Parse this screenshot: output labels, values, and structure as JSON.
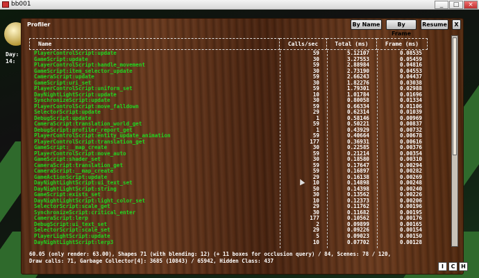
{
  "window": {
    "title": "bb001",
    "minimize": "_",
    "maximize": "□",
    "close": "×"
  },
  "hud": {
    "line1": "Day:",
    "line2": "14:"
  },
  "profiler": {
    "title": "Profiler",
    "buttons": {
      "by_name": "By Name",
      "by_frame": "By Frame",
      "resume": "Resume",
      "close": "X"
    },
    "columns": {
      "name": "Name",
      "calls": "Calls/sec",
      "total": "Total (ms)",
      "frame": "Frame (ms)"
    },
    "rows": [
      {
        "name": "PlayerControlScript:update",
        "calls": "59",
        "total": "5.12107",
        "frame": "0.08535"
      },
      {
        "name": "GameScript:update",
        "calls": "30",
        "total": "3.27553",
        "frame": "0.05459"
      },
      {
        "name": "PlayerControlScript:handle_movement",
        "calls": "59",
        "total": "2.88984",
        "frame": "0.04816"
      },
      {
        "name": "GameScript:item_selector_update",
        "calls": "30",
        "total": "2.73190",
        "frame": "0.04553"
      },
      {
        "name": "CameraScript:update",
        "calls": "59",
        "total": "2.66243",
        "frame": "0.04437"
      },
      {
        "name": "GameScript:uri_set",
        "calls": "30",
        "total": "1.82276",
        "frame": "0.03038"
      },
      {
        "name": "PlayerControlScript:uniform_set",
        "calls": "59",
        "total": "1.79301",
        "frame": "0.02988"
      },
      {
        "name": "DayNightLightScript:update",
        "calls": "10",
        "total": "1.01784",
        "frame": "0.01696"
      },
      {
        "name": "SynchronizeScript:update",
        "calls": "30",
        "total": "0.80058",
        "frame": "0.01334"
      },
      {
        "name": "PlayerControlScript:move_falldown",
        "calls": "59",
        "total": "0.66334",
        "frame": "0.01106"
      },
      {
        "name": "SelectorScript:update",
        "calls": "29",
        "total": "0.62314",
        "frame": "0.01039"
      },
      {
        "name": "DebugScript:update",
        "calls": "1",
        "total": "0.58146",
        "frame": "0.00969"
      },
      {
        "name": "CameraScript:translation_world_get",
        "calls": "59",
        "total": "0.50221",
        "frame": "0.00837"
      },
      {
        "name": "DebugScript:profiler_report_get",
        "calls": "1",
        "total": "0.43929",
        "frame": "0.00732"
      },
      {
        "name": "PlayerControlScript:entity_update_animation",
        "calls": "59",
        "total": "0.40664",
        "frame": "0.00678"
      },
      {
        "name": "PlayerControlScript:translation_get",
        "calls": "177",
        "total": "0.36931",
        "frame": "0.00616"
      },
      {
        "name": "GameScript:__map_create",
        "calls": "30",
        "total": "0.22585",
        "frame": "0.00376"
      },
      {
        "name": "PlayerControlScript:move_auto",
        "calls": "59",
        "total": "0.21214",
        "frame": "0.00354"
      },
      {
        "name": "GameScript:shader_set",
        "calls": "30",
        "total": "0.18580",
        "frame": "0.00310"
      },
      {
        "name": "CameraScript:translation_get",
        "calls": "59",
        "total": "0.17647",
        "frame": "0.00294"
      },
      {
        "name": "CameraScript:__map_create",
        "calls": "59",
        "total": "0.16897",
        "frame": "0.00282"
      },
      {
        "name": "GameActionScript:update",
        "calls": "29",
        "total": "0.16138",
        "frame": "0.00269"
      },
      {
        "name": "DayNightLightScript:ui_text_set",
        "calls": "10",
        "total": "0.14898",
        "frame": "0.00248"
      },
      {
        "name": "DayNightLightScript:string",
        "calls": "50",
        "total": "0.14398",
        "frame": "0.00240"
      },
      {
        "name": "GameScript:exists_set",
        "calls": "30",
        "total": "0.13562",
        "frame": "0.00226"
      },
      {
        "name": "DayNightLightScript:light_color_set",
        "calls": "10",
        "total": "0.12373",
        "frame": "0.00206"
      },
      {
        "name": "SelectorScript:scale_get",
        "calls": "29",
        "total": "0.11762",
        "frame": "0.00196"
      },
      {
        "name": "SynchronizeScript:critical_enter",
        "calls": "30",
        "total": "0.11682",
        "frame": "0.00195"
      },
      {
        "name": "CameraScript:lerp",
        "calls": "177",
        "total": "0.10562",
        "frame": "0.00176"
      },
      {
        "name": "DebugScript:ui_text_set",
        "calls": "2",
        "total": "0.09899",
        "frame": "0.00165"
      },
      {
        "name": "SelectorScript:scale_set",
        "calls": "29",
        "total": "0.09226",
        "frame": "0.00154"
      },
      {
        "name": "PlayerLightScript:update",
        "calls": "5",
        "total": "0.09023",
        "frame": "0.00150"
      },
      {
        "name": "DayNightLightScript:lerp3",
        "calls": "10",
        "total": "0.07702",
        "frame": "0.00128"
      }
    ]
  },
  "status": {
    "line1": "60.05 (only render: 63.00), Shapes 71 (with blending: 12) (+ 11 boxes for occlusion query) / 84, Scenes: 78 / 120,",
    "line2": "Draw calls: 71, Garbage Collector[4]: 3685 (10843) / 65942, Hidden Class: 437"
  },
  "corner_buttons": [
    "I",
    "C",
    "H"
  ]
}
